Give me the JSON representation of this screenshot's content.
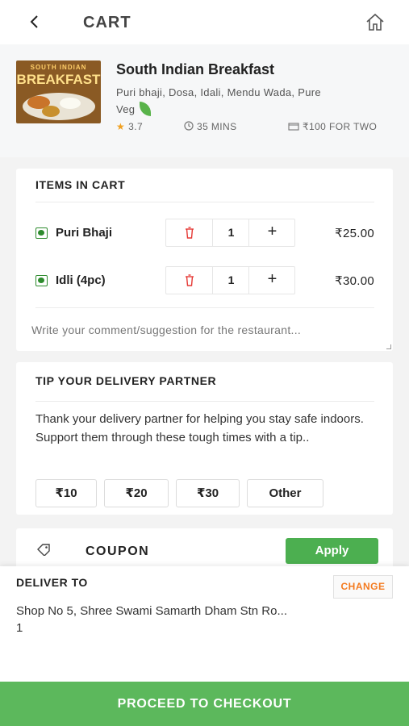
{
  "header": {
    "title": "CART"
  },
  "restaurant": {
    "thumb_line1": "SOUTH INDIAN",
    "thumb_line2": "BREAKFAST",
    "name": "South Indian Breakfast",
    "cuisines": "Puri bhaji, Dosa, Idali, Mendu Wada, Pure Veg",
    "rating": "3.7",
    "time": "35 MINS",
    "cost": "₹100 FOR TWO"
  },
  "cart": {
    "title": "ITEMS IN CART",
    "items": [
      {
        "name": "Puri Bhaji",
        "qty": "1",
        "price": "₹25.00"
      },
      {
        "name": "Idli (4pc)",
        "qty": "1",
        "price": "₹30.00"
      }
    ],
    "comment_placeholder": "Write your comment/suggestion for the restaurant..."
  },
  "tip": {
    "title": "TIP YOUR DELIVERY PARTNER",
    "text": "Thank your delivery partner for helping you stay safe indoors. Support them through these tough times with a tip..",
    "options": [
      "₹10",
      "₹20",
      "₹30",
      "Other"
    ]
  },
  "coupon": {
    "label": "COUPON",
    "apply": "Apply"
  },
  "delivery": {
    "title": "DELIVER TO",
    "change": "CHANGE",
    "address_line1": "Shop No 5, Shree Swami Samarth Dham Stn Ro...",
    "address_line2": "1"
  },
  "checkout": {
    "label": "PROCEED TO CHECKOUT"
  },
  "colors": {
    "accent_green": "#4caf50",
    "change_orange": "#f47b20",
    "veg_green": "#2e8b2e",
    "trash_red": "#e53935"
  }
}
